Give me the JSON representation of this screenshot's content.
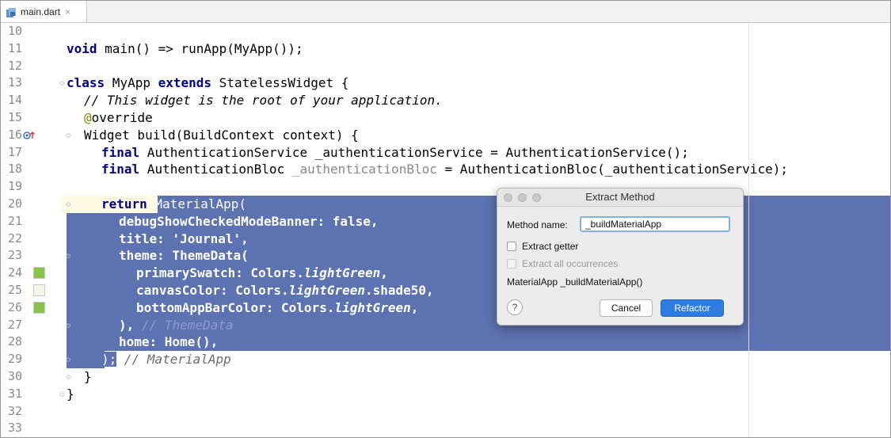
{
  "tab": {
    "filename": "main.dart",
    "close": "×"
  },
  "lines": [
    {
      "num": "10"
    },
    {
      "num": "11"
    },
    {
      "num": "12"
    },
    {
      "num": "13"
    },
    {
      "num": "14"
    },
    {
      "num": "15"
    },
    {
      "num": "16"
    },
    {
      "num": "17"
    },
    {
      "num": "18"
    },
    {
      "num": "19"
    },
    {
      "num": "20"
    },
    {
      "num": "21"
    },
    {
      "num": "22"
    },
    {
      "num": "23"
    },
    {
      "num": "24"
    },
    {
      "num": "25"
    },
    {
      "num": "26"
    },
    {
      "num": "27"
    },
    {
      "num": "28"
    },
    {
      "num": "29"
    },
    {
      "num": "30"
    },
    {
      "num": "31"
    },
    {
      "num": "32"
    },
    {
      "num": "33"
    }
  ],
  "code": {
    "l11": {
      "kw": "void",
      "rest": " main() => runApp(MyApp());"
    },
    "l13": {
      "kw1": "class",
      "mid": " MyApp ",
      "kw2": "extends",
      "rest": " StatelessWidget {"
    },
    "l14": "// This widget is the root of your application.",
    "l15": {
      "at": "@",
      "rest": "override"
    },
    "l16": "Widget build(BuildContext context) {",
    "l17": {
      "kw": "final",
      "rest": " AuthenticationService _authenticationService = AuthenticationService();"
    },
    "l18": {
      "kw": "final",
      "a": " AuthenticationBloc ",
      "field": "_authenticationBloc",
      "b": " = AuthenticationBloc(_authenticationService);"
    },
    "l20": {
      "kw": "return",
      "rest": " MaterialApp("
    },
    "l21": {
      "a": "debugShowCheckedModeBanner: ",
      "kw": "false",
      "b": ","
    },
    "l22": {
      "a": "title: ",
      "str": "'Journal'",
      "b": ","
    },
    "l23": "theme: ThemeData(",
    "l24": {
      "a": "primarySwatch: Colors.",
      "it": "lightGreen",
      "b": ","
    },
    "l25": {
      "a": "canvasColor: Colors.",
      "it": "lightGreen",
      "kw": ".shade50",
      "b": ","
    },
    "l26": {
      "a": "bottomAppBarColor: Colors.",
      "it": "lightGreen",
      "b": ","
    },
    "l27": {
      "a": "), ",
      "cm": "// ThemeData"
    },
    "l28": "home: Home(),",
    "l29": {
      "a": ");",
      "cm": " // MaterialApp"
    },
    "l30": "}",
    "l31": "}"
  },
  "colors": {
    "swatch_light_green": "#8bc34a",
    "swatch_light_green_50": "#f1f8e9",
    "selection": "#5d72b0",
    "keyword": "#000080"
  },
  "icons": {
    "override": "override-method-icon",
    "file": "dart-file-icon",
    "help": "help-icon"
  },
  "dialog": {
    "title": "Extract Method",
    "method_name_label": "Method name:",
    "method_name_value": "_buildMaterialApp",
    "extract_getter": "Extract getter",
    "extract_all": "Extract all occurrences",
    "signature": "MaterialApp _buildMaterialApp()",
    "help": "?",
    "cancel": "Cancel",
    "refactor": "Refactor"
  }
}
